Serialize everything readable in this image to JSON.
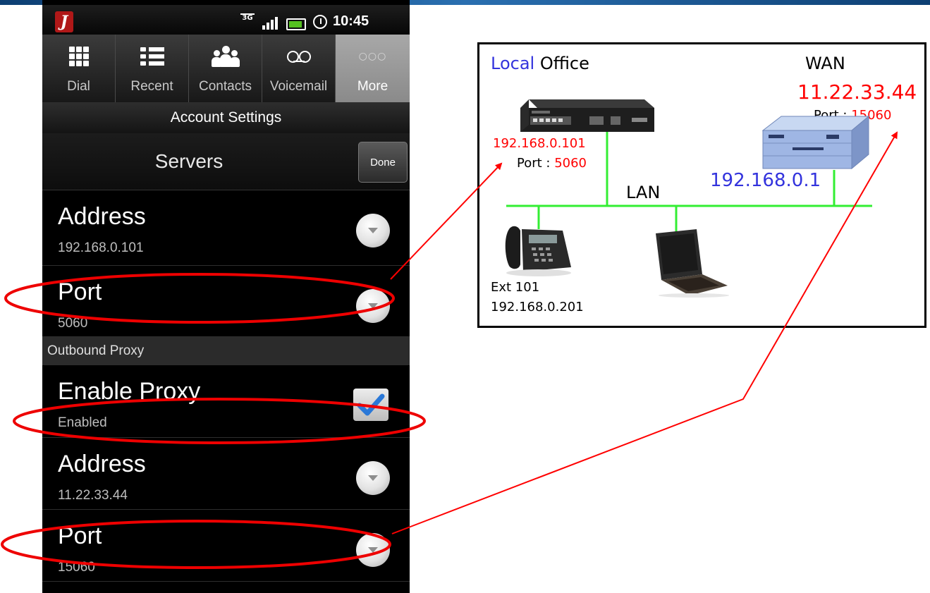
{
  "status_bar": {
    "network": "3G",
    "time": "10:45"
  },
  "tabs": [
    {
      "label": "Dial",
      "icon": "dial-icon"
    },
    {
      "label": "Recent",
      "icon": "recent-icon"
    },
    {
      "label": "Contacts",
      "icon": "contacts-icon"
    },
    {
      "label": "Voicemail",
      "icon": "voicemail-icon"
    },
    {
      "label": "More",
      "icon": "more-icon",
      "active": true
    }
  ],
  "header": {
    "title": "Account Settings"
  },
  "servers": {
    "title": "Servers",
    "done_label": "Done"
  },
  "settings": {
    "server_address": {
      "label": "Address",
      "value": "192.168.0.101"
    },
    "server_port": {
      "label": "Port",
      "value": "5060"
    },
    "section_outbound": "Outbound Proxy",
    "enable_proxy": {
      "label": "Enable Proxy",
      "value": "Enabled",
      "checked": true
    },
    "proxy_address": {
      "label": "Address",
      "value": "11.22.33.44"
    },
    "proxy_port": {
      "label": "Port",
      "value": "15060"
    }
  },
  "diagram": {
    "title_local": "Local",
    "title_office": " Office",
    "wan_label": "WAN",
    "wan_ip": "11.22.33.44",
    "wan_port_label": "Port : ",
    "wan_port_value": "15060",
    "pbx_ip": "192.168.0.101",
    "pbx_port_label": "Port : ",
    "pbx_port_value": "5060",
    "lan_label": "LAN",
    "router_ip": "192.168.0.1",
    "phone_ext": "Ext 101",
    "phone_ip": "192.168.0.201"
  },
  "colors": {
    "accent_red": "#ff0000",
    "accent_blue": "#3333dd",
    "lan_green": "#33ee33",
    "check_blue": "#2a78d8"
  }
}
